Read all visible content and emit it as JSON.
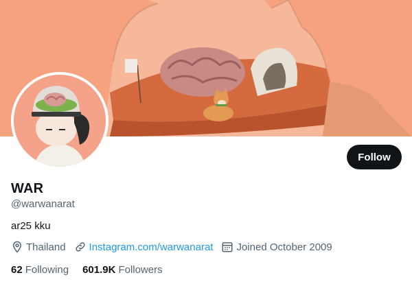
{
  "colors": {
    "banner_bg": "#f7a27e",
    "avatar_bg": "#f4a38a",
    "button_bg": "#0f1419",
    "link": "#1d9bf0",
    "muted": "#536471"
  },
  "header": {
    "follow_label": "Follow"
  },
  "profile": {
    "name": "WAR",
    "handle": "@warwanarat",
    "bio": "ar25 kku",
    "location": "Thailand",
    "website": "Instagram.com/warwanarat",
    "joined": "Joined October 2009"
  },
  "stats": {
    "following_count": "62",
    "following_label": "Following",
    "followers_count": "601.9K",
    "followers_label": "Followers"
  },
  "icons": {
    "location": "location-pin-icon",
    "link": "link-icon",
    "calendar": "calendar-icon"
  }
}
